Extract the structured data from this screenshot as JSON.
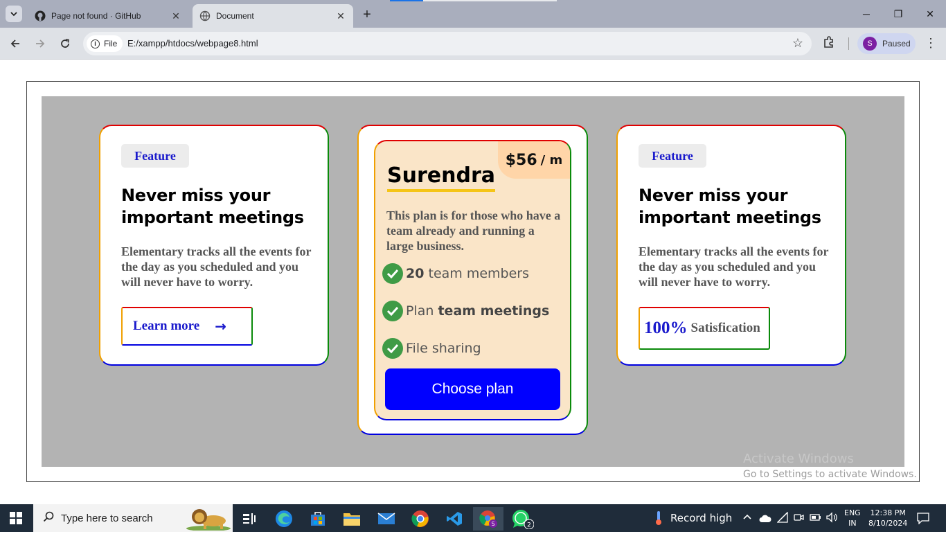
{
  "browser": {
    "tabs": [
      {
        "title": "Page not found · GitHub",
        "close": "✕"
      },
      {
        "title": "Document",
        "close": "✕"
      }
    ],
    "new_tab": "+",
    "window_buttons": {
      "minimize": "─",
      "restore": "❐",
      "close": "✕"
    },
    "site_chip": "File",
    "url": "E:/xampp/htdocs/webpage8.html",
    "profile": {
      "initial": "S",
      "status": "Paused"
    }
  },
  "page": {
    "left_card": {
      "badge": "Feature",
      "heading": "Never miss your important meetings",
      "description": "Elementary tracks all the events for the day as you scheduled and you will never have to worry.",
      "button": "Learn more",
      "button_arrow": "→"
    },
    "middle_card": {
      "price": "$56",
      "per": "/ m",
      "plan_name": "Surendra",
      "description": "This plan is for those who have a team already and running a large business.",
      "features": [
        {
          "bold": "20",
          "text": " team members"
        },
        {
          "text": "Plan ",
          "bold": "team meetings"
        },
        {
          "text": "File sharing"
        }
      ],
      "button": "Choose plan"
    },
    "right_card": {
      "badge": "Feature",
      "heading": "Never miss your important meetings",
      "description": "Elementary tracks all the events for the day as you scheduled and you will never have to worry.",
      "percent": "100%",
      "label": "Satisfication"
    },
    "watermark": {
      "line1": "Activate Windows",
      "line2": "Go to Settings to activate Windows."
    }
  },
  "taskbar": {
    "search_placeholder": "Type here to search",
    "weather": "Record high",
    "language": {
      "line1": "ENG",
      "line2": "IN"
    },
    "time": "12:38 PM",
    "date": "8/10/2024",
    "whatsapp_badge": "2"
  }
}
